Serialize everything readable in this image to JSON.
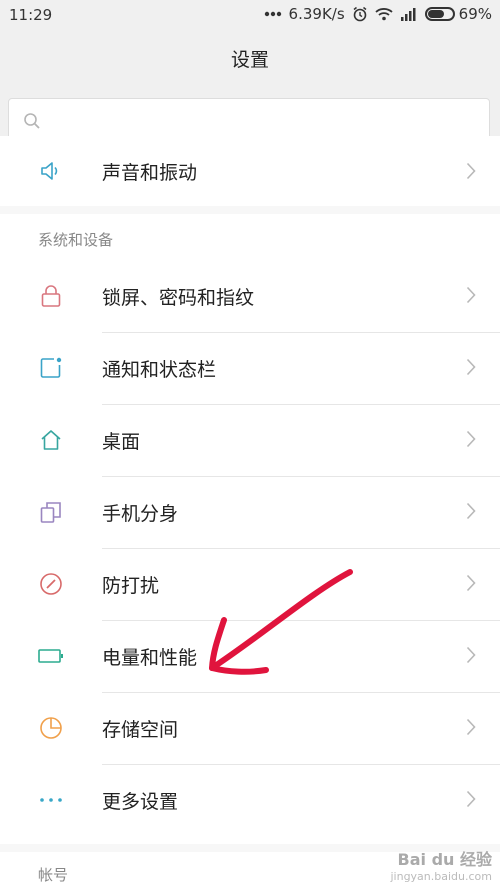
{
  "status_bar": {
    "time": "11:29",
    "speed": "6.39K/s",
    "battery": "69%",
    "battery_level": 0.69
  },
  "header": {
    "title": "设置"
  },
  "search": {
    "placeholder": ""
  },
  "sound_row": {
    "label": "声音和振动"
  },
  "section_system": {
    "label": "系统和设备"
  },
  "items": [
    {
      "label": "锁屏、密码和指纹",
      "icon": "lock-icon"
    },
    {
      "label": "通知和状态栏",
      "icon": "notification-icon"
    },
    {
      "label": "桌面",
      "icon": "home-icon"
    },
    {
      "label": "手机分身",
      "icon": "second-space-icon"
    },
    {
      "label": "防打扰",
      "icon": "do-not-disturb-icon"
    },
    {
      "label": "电量和性能",
      "icon": "battery-icon"
    },
    {
      "label": "存储空间",
      "icon": "storage-icon"
    },
    {
      "label": "更多设置",
      "icon": "more-icon"
    }
  ],
  "section_account": {
    "label": "帐号"
  },
  "watermark": {
    "brand": "Bai du 经验",
    "url": "jingyan.baidu.com"
  },
  "colors": {
    "lock": "#d9767f",
    "notify": "#3aa3c8",
    "home": "#37a6a0",
    "clone": "#9a86c0",
    "dnd": "#d86a6a",
    "battery": "#2cab8f",
    "storage": "#f0a04b",
    "more": "#38a7c7",
    "arrow": "#e0143d"
  }
}
